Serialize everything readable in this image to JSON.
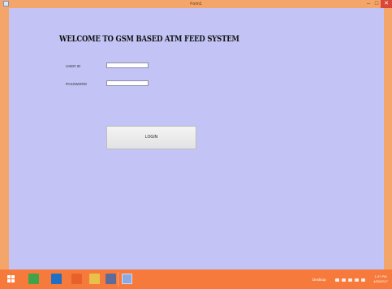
{
  "window": {
    "title": "Form1",
    "minimize_glyph": "–",
    "maximize_glyph": "□",
    "close_glyph": "✕"
  },
  "form": {
    "heading": "WELCOME TO  GSM BASED ATM FEED SYSTEM",
    "userid_label": "USER ID",
    "userid_value": "",
    "password_label": "PASSWORD",
    "password_value": "",
    "login_label": "LOGIN"
  },
  "taskbar": {
    "desktop_label": "Desktop",
    "time": "1:07 PM",
    "date": "4/30/2017",
    "icons": [
      "windows-start-icon",
      "store-icon",
      "internet-explorer-icon",
      "media-player-icon",
      "file-explorer-icon",
      "tools-icon",
      "form-app-icon"
    ]
  },
  "colors": {
    "title_bar": "#f4a56a",
    "form_background": "#c3c3f5",
    "taskbar": "#f57a3b",
    "close_button": "#d9473a"
  }
}
